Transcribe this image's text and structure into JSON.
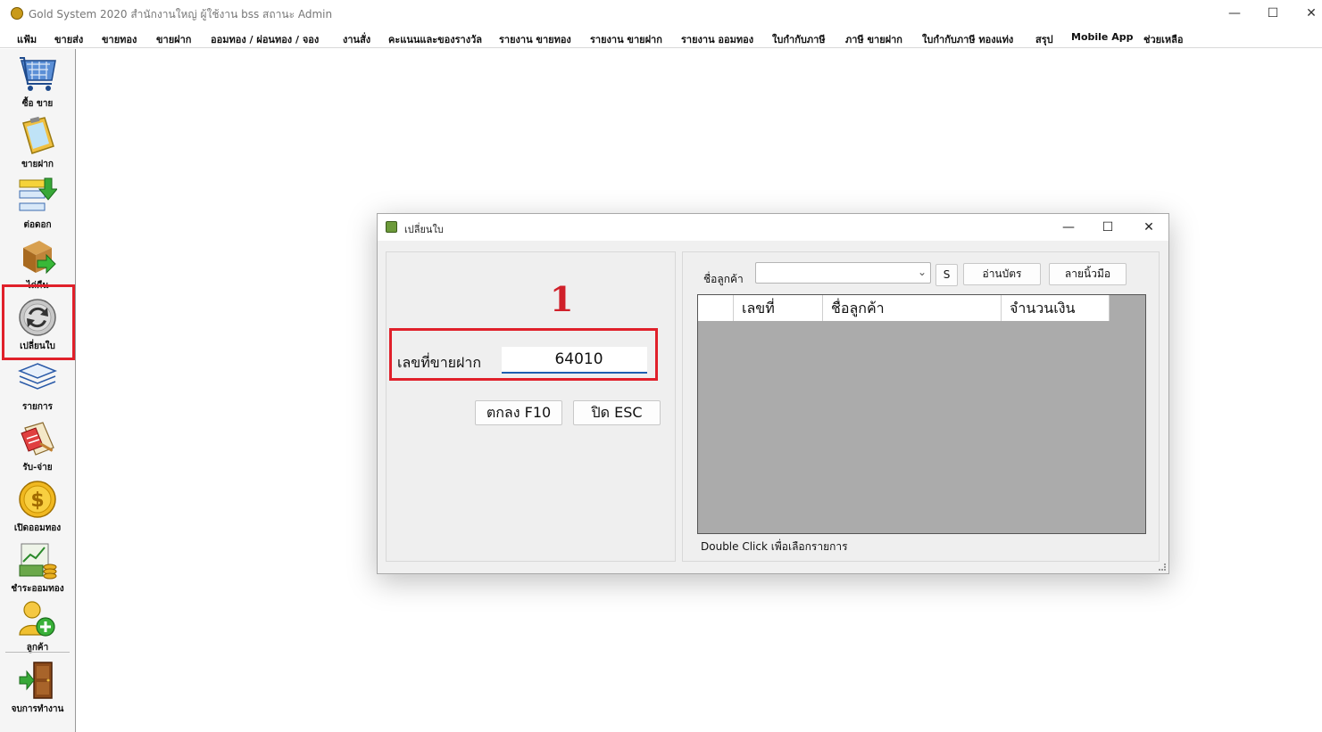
{
  "window": {
    "title": "Gold System 2020  สำนักงานใหญ่ ผู้ใช้งาน bss สถานะ Admin",
    "minimize": "—",
    "maximize": "☐",
    "close": "✕"
  },
  "menu": [
    "แฟ้ม",
    "ขายส่ง",
    "ขายทอง",
    "ขายฝาก",
    "ออมทอง / ผ่อนทอง / จอง",
    "งานสั่ง",
    "คะแนนและของรางวัล",
    "รายงาน ขายทอง",
    "รายงาน ขายฝาก",
    "รายงาน ออมทอง",
    "ใบกำกับภาษี",
    "ภาษี ขายฝาก",
    "ใบกำกับภาษี ทองแท่ง",
    "สรุป",
    "Mobile App",
    "ช่วยเหลือ"
  ],
  "toolbar": [
    {
      "label": "ซื้อ ขาย",
      "icon": "cart-icon"
    },
    {
      "label": "ขายฝาก",
      "icon": "clipboard-icon"
    },
    {
      "label": "ต่อดอก",
      "icon": "arrow-down-list-icon"
    },
    {
      "label": "ไถ่คืน",
      "icon": "box-arrow-icon"
    },
    {
      "label": "เปลี่ยนใบ",
      "icon": "exchange-icon"
    },
    {
      "label": "รายการ",
      "icon": "layers-icon"
    },
    {
      "label": "รับ-จ่าย",
      "icon": "receipt-icon"
    },
    {
      "label": "เปิดออมทอง",
      "icon": "coin-icon"
    },
    {
      "label": "ชำระออมทอง",
      "icon": "money-chart-icon"
    },
    {
      "label": "ลูกค้า",
      "icon": "add-user-icon"
    },
    {
      "label": "จบการทำงาน",
      "icon": "exit-door-icon"
    }
  ],
  "dialog": {
    "title": "เปลี่ยนใบ",
    "annotation_number": "1",
    "field_label": "เลขที่ขายฝาก",
    "field_value": "64010",
    "ok_button": "ตกลง F10",
    "close_button": "ปิด ESC",
    "customer_label": "ชื่อลูกค้า",
    "customer_value": "",
    "s_button": "S",
    "read_card_button": "อ่านบัตร",
    "fingerprint_button": "ลายนิ้วมือ",
    "columns": [
      "",
      "เลขที่",
      "ชื่อลูกค้า",
      "จำนวนเงิน"
    ],
    "rows": [],
    "hint": "Double Click เพื่อเลือกรายการ"
  },
  "colors": {
    "highlight_red": "#e0202a",
    "grid_bg": "#ababab",
    "input_underline": "#1f5fb0"
  }
}
